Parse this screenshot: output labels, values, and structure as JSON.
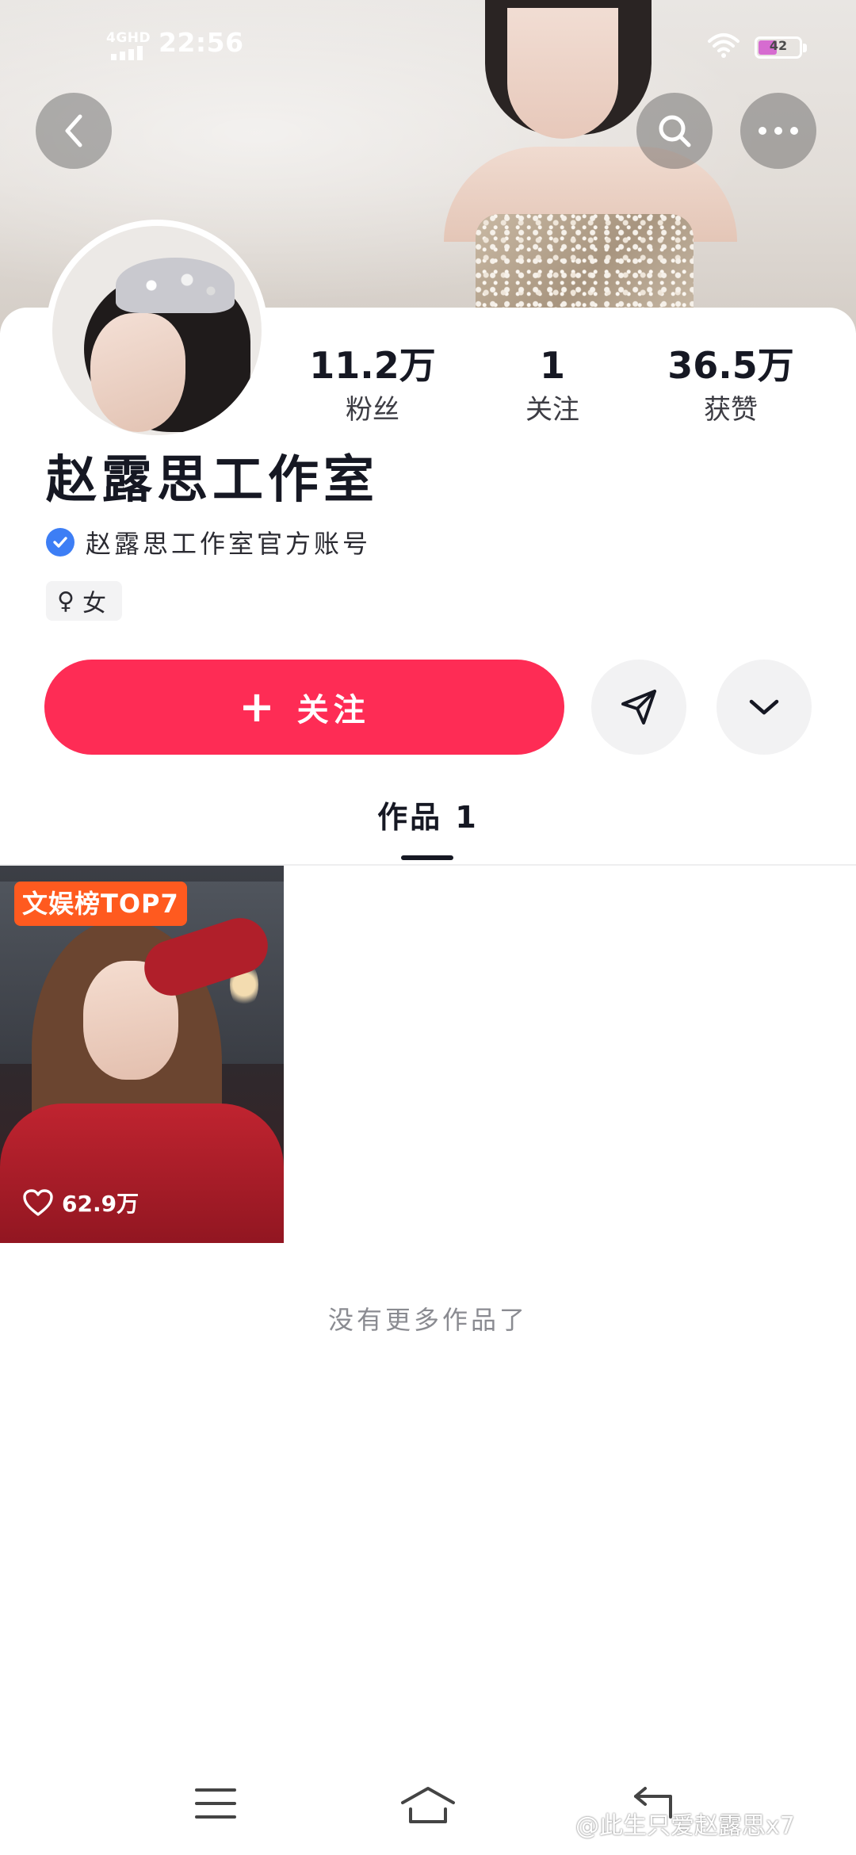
{
  "status_bar": {
    "network": "4GHD",
    "time": "22:56",
    "battery": "42"
  },
  "profile": {
    "name": "赵露思工作室",
    "verified_text": "赵露思工作室官方账号",
    "gender_symbol": "♀",
    "gender": "女"
  },
  "stats": [
    {
      "value": "11.2万",
      "label": "粉丝"
    },
    {
      "value": "1",
      "label": "关注"
    },
    {
      "value": "36.5万",
      "label": "获赞"
    }
  ],
  "actions": {
    "follow_plus": "+",
    "follow_label": "关注"
  },
  "tabs": {
    "works_label": "作品 1"
  },
  "works": [
    {
      "badge": "文娱榜TOP7",
      "likes": "62.9万"
    }
  ],
  "footer_text": "没有更多作品了",
  "watermark": "@此生只爱赵露思x7",
  "colors": {
    "accent": "#fe2c55",
    "verify": "#3d7ef5",
    "rank_badge": "#ff5a1f",
    "battery_fill": "#d66cd0"
  },
  "icons": {
    "back": "back-icon",
    "search": "search-icon",
    "more": "more-icon",
    "share": "send-icon",
    "expand": "chevron-down-icon",
    "like": "heart-icon",
    "nav_menu": "menu-icon",
    "nav_home": "home-icon",
    "nav_back": "return-icon"
  }
}
